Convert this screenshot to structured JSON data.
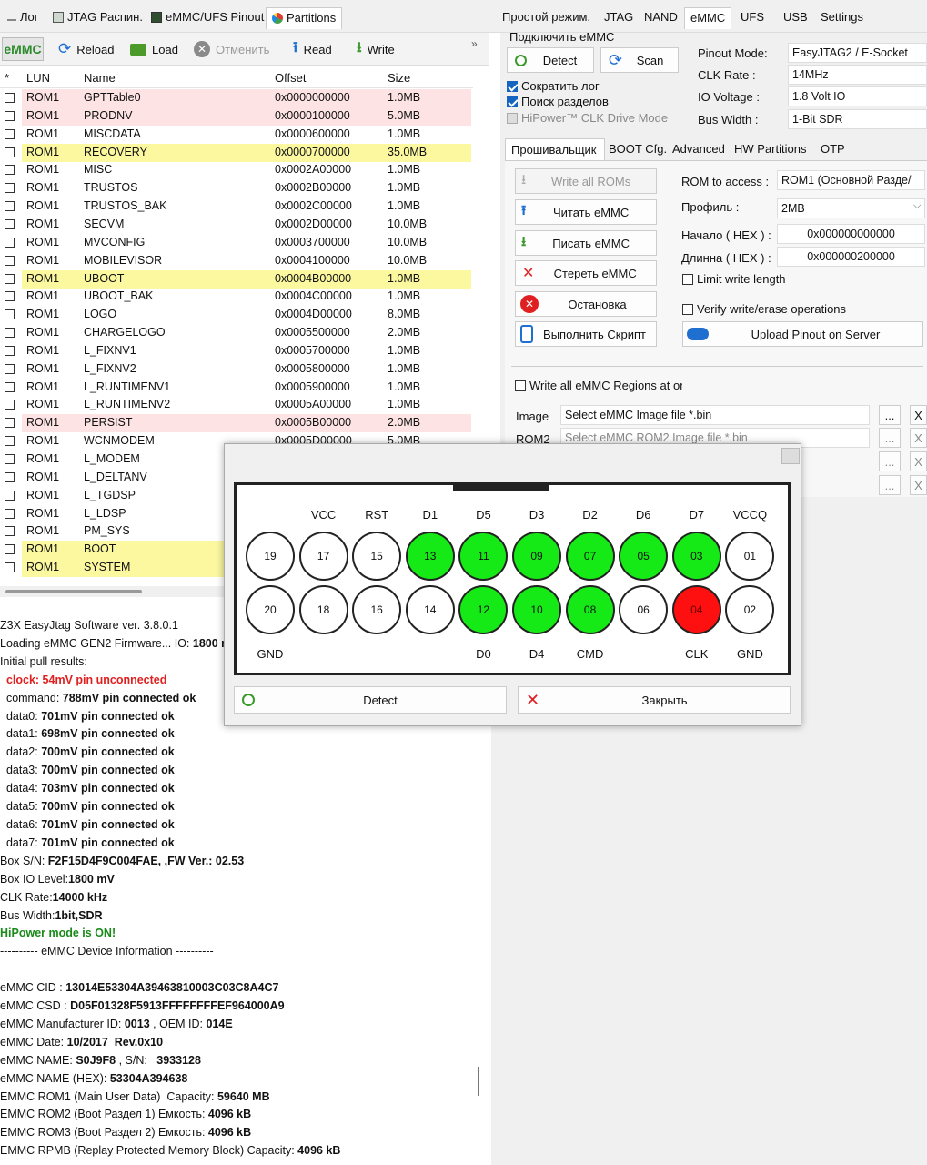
{
  "top_tabs_left": [
    {
      "label": "Лог"
    },
    {
      "label": "JTAG Распин."
    },
    {
      "label": "eMMC/UFS Pinout"
    },
    {
      "label": "Partitions"
    }
  ],
  "top_tabs_right": [
    {
      "label": "Простой режим."
    },
    {
      "label": "JTAG"
    },
    {
      "label": "NAND"
    },
    {
      "label": "eMMC"
    },
    {
      "label": "UFS"
    },
    {
      "label": "USB"
    },
    {
      "label": "Settings"
    }
  ],
  "toolbar": {
    "tag": "eMMC",
    "reload": "Reload",
    "load": "Load",
    "cancel": "Отменить",
    "read": "Read",
    "write": "Write",
    "more": "»"
  },
  "table": {
    "headers": {
      "star": "*",
      "lun": "LUN",
      "name": "Name",
      "offset": "Offset",
      "size": "Size"
    },
    "rows": [
      {
        "lun": "ROM1",
        "name": "GPTTable0",
        "offset": "0x0000000000",
        "size": "1.0MB",
        "hl": "red"
      },
      {
        "lun": "ROM1",
        "name": "PRODNV",
        "offset": "0x0000100000",
        "size": "5.0MB",
        "hl": "red"
      },
      {
        "lun": "ROM1",
        "name": "MISCDATA",
        "offset": "0x0000600000",
        "size": "1.0MB",
        "hl": ""
      },
      {
        "lun": "ROM1",
        "name": "RECOVERY",
        "offset": "0x0000700000",
        "size": "35.0MB",
        "hl": "yellow"
      },
      {
        "lun": "ROM1",
        "name": "MISC",
        "offset": "0x0002A00000",
        "size": "1.0MB",
        "hl": ""
      },
      {
        "lun": "ROM1",
        "name": "TRUSTOS",
        "offset": "0x0002B00000",
        "size": "1.0MB",
        "hl": ""
      },
      {
        "lun": "ROM1",
        "name": "TRUSTOS_BAK",
        "offset": "0x0002C00000",
        "size": "1.0MB",
        "hl": ""
      },
      {
        "lun": "ROM1",
        "name": "SECVM",
        "offset": "0x0002D00000",
        "size": "10.0MB",
        "hl": ""
      },
      {
        "lun": "ROM1",
        "name": "MVCONFIG",
        "offset": "0x0003700000",
        "size": "10.0MB",
        "hl": ""
      },
      {
        "lun": "ROM1",
        "name": "MOBILEVISOR",
        "offset": "0x0004100000",
        "size": "10.0MB",
        "hl": ""
      },
      {
        "lun": "ROM1",
        "name": "UBOOT",
        "offset": "0x0004B00000",
        "size": "1.0MB",
        "hl": "yellow"
      },
      {
        "lun": "ROM1",
        "name": "UBOOT_BAK",
        "offset": "0x0004C00000",
        "size": "1.0MB",
        "hl": ""
      },
      {
        "lun": "ROM1",
        "name": "LOGO",
        "offset": "0x0004D00000",
        "size": "8.0MB",
        "hl": ""
      },
      {
        "lun": "ROM1",
        "name": "CHARGELOGO",
        "offset": "0x0005500000",
        "size": "2.0MB",
        "hl": ""
      },
      {
        "lun": "ROM1",
        "name": "L_FIXNV1",
        "offset": "0x0005700000",
        "size": "1.0MB",
        "hl": ""
      },
      {
        "lun": "ROM1",
        "name": "L_FIXNV2",
        "offset": "0x0005800000",
        "size": "1.0MB",
        "hl": ""
      },
      {
        "lun": "ROM1",
        "name": "L_RUNTIMENV1",
        "offset": "0x0005900000",
        "size": "1.0MB",
        "hl": ""
      },
      {
        "lun": "ROM1",
        "name": "L_RUNTIMENV2",
        "offset": "0x0005A00000",
        "size": "1.0MB",
        "hl": ""
      },
      {
        "lun": "ROM1",
        "name": "PERSIST",
        "offset": "0x0005B00000",
        "size": "2.0MB",
        "hl": "red"
      },
      {
        "lun": "ROM1",
        "name": "WCNMODEM",
        "offset": "0x0005D00000",
        "size": "5.0MB",
        "hl": ""
      },
      {
        "lun": "ROM1",
        "name": "L_MODEM",
        "offset": "",
        "size": "",
        "hl": ""
      },
      {
        "lun": "ROM1",
        "name": "L_DELTANV",
        "offset": "",
        "size": "",
        "hl": ""
      },
      {
        "lun": "ROM1",
        "name": "L_TGDSP",
        "offset": "",
        "size": "",
        "hl": ""
      },
      {
        "lun": "ROM1",
        "name": "L_LDSP",
        "offset": "",
        "size": "",
        "hl": ""
      },
      {
        "lun": "ROM1",
        "name": "PM_SYS",
        "offset": "",
        "size": "",
        "hl": ""
      },
      {
        "lun": "ROM1",
        "name": "BOOT",
        "offset": "",
        "size": "",
        "hl": "yellow"
      },
      {
        "lun": "ROM1",
        "name": "SYSTEM",
        "offset": "",
        "size": "",
        "hl": "yellow"
      }
    ]
  },
  "log": [
    {
      "parts": [
        {
          "t": "Z3X EasyJtag Software ver. 3.8.0.1",
          "c": ""
        }
      ]
    },
    {
      "parts": [
        {
          "t": "Loading eMMC GEN2 Firmware... IO: ",
          "c": ""
        },
        {
          "t": "1800 m",
          "c": "b"
        }
      ]
    },
    {
      "parts": [
        {
          "t": "Initial pull results:",
          "c": ""
        }
      ]
    },
    {
      "parts": [
        {
          "t": "  clock: 54mV pin unconnected",
          "c": "redt"
        }
      ]
    },
    {
      "parts": [
        {
          "t": "  command: ",
          "c": ""
        },
        {
          "t": "788mV pin connected ok",
          "c": "b"
        }
      ]
    },
    {
      "parts": [
        {
          "t": "  data0: ",
          "c": ""
        },
        {
          "t": "701mV pin connected ok",
          "c": "b"
        }
      ]
    },
    {
      "parts": [
        {
          "t": "  data1: ",
          "c": ""
        },
        {
          "t": "698mV pin connected ok",
          "c": "b"
        }
      ]
    },
    {
      "parts": [
        {
          "t": "  data2: ",
          "c": ""
        },
        {
          "t": "700mV pin connected ok",
          "c": "b"
        }
      ]
    },
    {
      "parts": [
        {
          "t": "  data3: ",
          "c": ""
        },
        {
          "t": "700mV pin connected ok",
          "c": "b"
        }
      ]
    },
    {
      "parts": [
        {
          "t": "  data4: ",
          "c": ""
        },
        {
          "t": "703mV pin connected ok",
          "c": "b"
        }
      ]
    },
    {
      "parts": [
        {
          "t": "  data5: ",
          "c": ""
        },
        {
          "t": "700mV pin connected ok",
          "c": "b"
        }
      ]
    },
    {
      "parts": [
        {
          "t": "  data6: ",
          "c": ""
        },
        {
          "t": "701mV pin connected ok",
          "c": "b"
        }
      ]
    },
    {
      "parts": [
        {
          "t": "  data7: ",
          "c": ""
        },
        {
          "t": "701mV pin connected ok",
          "c": "b"
        }
      ]
    },
    {
      "parts": [
        {
          "t": "Box S/N: ",
          "c": ""
        },
        {
          "t": "F2F15D4F9C004FAE, ,FW Ver.: 02.53",
          "c": "b"
        }
      ]
    },
    {
      "parts": [
        {
          "t": "Box IO Level:",
          "c": ""
        },
        {
          "t": "1800 mV",
          "c": "b"
        }
      ]
    },
    {
      "parts": [
        {
          "t": "CLK Rate:",
          "c": ""
        },
        {
          "t": "14000 kHz",
          "c": "b"
        }
      ]
    },
    {
      "parts": [
        {
          "t": "Bus Width:",
          "c": ""
        },
        {
          "t": "1bit,SDR",
          "c": "b"
        }
      ]
    },
    {
      "parts": [
        {
          "t": "HiPower mode is ON!",
          "c": "greent"
        }
      ]
    },
    {
      "parts": [
        {
          "t": "---------- eMMC Device Information ----------",
          "c": ""
        }
      ]
    },
    {
      "parts": [
        {
          "t": " ",
          "c": ""
        }
      ]
    },
    {
      "parts": [
        {
          "t": "eMMC CID : ",
          "c": ""
        },
        {
          "t": "13014E53304A39463810003C03C8A4C7",
          "c": "b"
        }
      ]
    },
    {
      "parts": [
        {
          "t": "eMMC CSD : ",
          "c": ""
        },
        {
          "t": "D05F01328F5913FFFFFFFFEF964000A9",
          "c": "b"
        }
      ]
    },
    {
      "parts": [
        {
          "t": "eMMC Manufacturer ID: ",
          "c": ""
        },
        {
          "t": "0013",
          "c": "b"
        },
        {
          "t": " , OEM ID: ",
          "c": ""
        },
        {
          "t": "014E",
          "c": "b"
        }
      ]
    },
    {
      "parts": [
        {
          "t": "eMMC Date: ",
          "c": ""
        },
        {
          "t": "10/2017  Rev.0x10",
          "c": "b"
        }
      ]
    },
    {
      "parts": [
        {
          "t": "eMMC NAME: ",
          "c": ""
        },
        {
          "t": "S0J9F8",
          "c": "b"
        },
        {
          "t": " , S/N:   ",
          "c": ""
        },
        {
          "t": "3933128",
          "c": "b"
        }
      ]
    },
    {
      "parts": [
        {
          "t": "eMMC NAME (HEX): ",
          "c": ""
        },
        {
          "t": "53304A394638",
          "c": "b"
        }
      ]
    },
    {
      "parts": [
        {
          "t": "EMMC ROM1 (Main User Data)  Capacity: ",
          "c": ""
        },
        {
          "t": "59640 MB",
          "c": "b"
        }
      ]
    },
    {
      "parts": [
        {
          "t": "EMMC ROM2 (Boot Раздел 1) Емкость: ",
          "c": ""
        },
        {
          "t": "4096 kB",
          "c": "b"
        }
      ]
    },
    {
      "parts": [
        {
          "t": "EMMC ROM3 (Boot Раздел 2) Емкость: ",
          "c": ""
        },
        {
          "t": "4096 kB",
          "c": "b"
        }
      ]
    },
    {
      "parts": [
        {
          "t": "EMMC RPMB (Replay Protected Memory Block) Capacity: ",
          "c": ""
        },
        {
          "t": "4096 kB",
          "c": "b"
        }
      ]
    }
  ],
  "connect": {
    "group_label": "Подключить eMMC",
    "detect": "Detect",
    "scan": "Scan",
    "shorten_log": "Сократить лог",
    "search_partitions": "Поиск разделов",
    "hipower": "HiPower™ CLK Drive Mode",
    "pinout_mode_label": "Pinout Mode:",
    "pinout_mode_value": "EasyJTAG2 / E-Socket",
    "clk_rate_label": "CLK Rate :",
    "clk_rate_value": "14MHz",
    "io_voltage_label": "IO Voltage :",
    "io_voltage_value": "1.8 Volt IO",
    "bus_width_label": "Bus Width :",
    "bus_width_value": "1-Bit SDR"
  },
  "subtabs": [
    {
      "label": "Прошивальщик"
    },
    {
      "label": "BOOT Cfg."
    },
    {
      "label": "Advanced"
    },
    {
      "label": "HW Partitions"
    },
    {
      "label": "OTP"
    }
  ],
  "flasher": {
    "write_all": "Write all ROMs",
    "read_emmc": "Читать eMMC",
    "write_emmc": "Писать eMMC",
    "erase_emmc": "Стереть eMMC",
    "stop": "Остановка",
    "run_script": "Выполнить Скрипт",
    "rom_access_label": "ROM to access :",
    "rom_access_value": "ROM1 (Основной Разде/",
    "profile_label": "Профиль :",
    "profile_value": "2MB",
    "start_label": "Начало ( HEX ) :",
    "start_value": "0x000000000000",
    "length_label": "Длинна ( HEX ) :",
    "length_value": "0x000000200000",
    "limit_write": "Limit write length",
    "verify": "Verify write/erase operations",
    "upload_pinout": "Upload Pinout on Server",
    "write_all_regions": "Write all eMMC Regions at onc",
    "image_label": "Image",
    "image_placeholder": "Select eMMC Image file *.bin",
    "rom2_label": "ROM2",
    "rom2_placeholder": "Select eMMC ROM2 Image file *.bin",
    "dots": "...",
    "x": "X"
  },
  "dialog": {
    "top_labels": [
      "",
      "VCC",
      "RST",
      "D1",
      "D5",
      "D3",
      "D2",
      "D6",
      "D7",
      "VCCQ"
    ],
    "top_pins": [
      {
        "num": "19",
        "state": "none"
      },
      {
        "num": "17",
        "state": "none"
      },
      {
        "num": "15",
        "state": "none"
      },
      {
        "num": "13",
        "state": "green"
      },
      {
        "num": "11",
        "state": "green"
      },
      {
        "num": "09",
        "state": "green"
      },
      {
        "num": "07",
        "state": "green"
      },
      {
        "num": "05",
        "state": "green"
      },
      {
        "num": "03",
        "state": "green"
      },
      {
        "num": "01",
        "state": "none"
      }
    ],
    "bottom_pins": [
      {
        "num": "20",
        "state": "none"
      },
      {
        "num": "18",
        "state": "none"
      },
      {
        "num": "16",
        "state": "none"
      },
      {
        "num": "14",
        "state": "none"
      },
      {
        "num": "12",
        "state": "green"
      },
      {
        "num": "10",
        "state": "green"
      },
      {
        "num": "08",
        "state": "green"
      },
      {
        "num": "06",
        "state": "none"
      },
      {
        "num": "04",
        "state": "red"
      },
      {
        "num": "02",
        "state": "none"
      }
    ],
    "bottom_labels": [
      "GND",
      "",
      "",
      "",
      "D0",
      "D4",
      "CMD",
      "",
      "CLK",
      "GND"
    ],
    "detect": "Detect",
    "close": "Закрыть",
    "colors": {
      "green": "#16ea16",
      "red": "#ff1010"
    }
  }
}
